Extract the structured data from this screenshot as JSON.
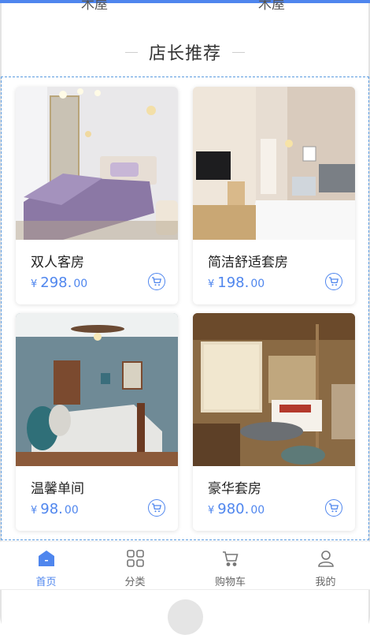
{
  "previous_section": {
    "left_label": "木屋",
    "right_label": "木屋"
  },
  "section": {
    "title": "店长推荐"
  },
  "products": [
    {
      "name": "双人客房",
      "currency": "¥",
      "price_int": "298.",
      "price_dec": "00"
    },
    {
      "name": "简洁舒适套房",
      "currency": "¥",
      "price_int": "198.",
      "price_dec": "00"
    },
    {
      "name": "温馨单间",
      "currency": "¥",
      "price_int": "98.",
      "price_dec": "00"
    },
    {
      "name": "豪华套房",
      "currency": "¥",
      "price_int": "980.",
      "price_dec": "00"
    }
  ],
  "tabbar": {
    "items": [
      {
        "label": "首页",
        "icon": "home-icon",
        "active": true
      },
      {
        "label": "分类",
        "icon": "grid-icon",
        "active": false
      },
      {
        "label": "购物车",
        "icon": "cart-icon",
        "active": false
      },
      {
        "label": "我的",
        "icon": "user-icon",
        "active": false
      }
    ]
  },
  "colors": {
    "accent": "#4f86ee",
    "text": "#222222",
    "muted": "#666666"
  }
}
